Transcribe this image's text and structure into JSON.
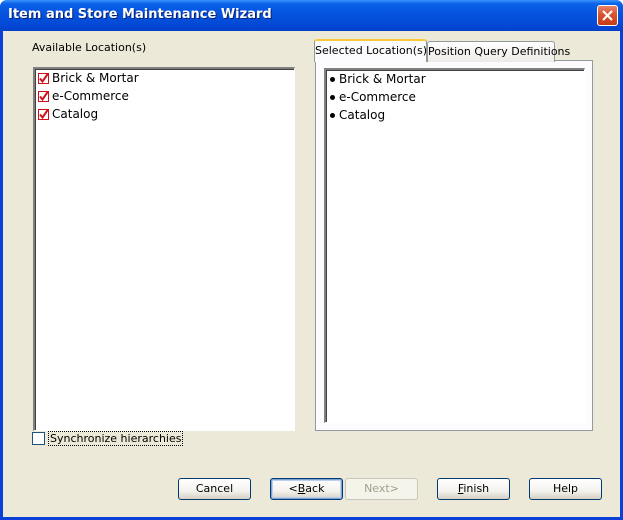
{
  "window": {
    "title": "Item and Store Maintenance Wizard"
  },
  "available": {
    "label": "Available Location(s)",
    "items": [
      {
        "label": "Brick & Mortar",
        "checked": true
      },
      {
        "label": "e-Commerce",
        "checked": true
      },
      {
        "label": "Catalog",
        "checked": true
      }
    ]
  },
  "tabs": [
    {
      "label": "Selected Location(s)",
      "active": true
    },
    {
      "label": "Position Query Definitions",
      "active": false
    }
  ],
  "selected": {
    "items": [
      {
        "label": "Brick & Mortar"
      },
      {
        "label": "e-Commerce"
      },
      {
        "label": "Catalog"
      }
    ]
  },
  "options": {
    "sync_label": "Synchronize hierarchies",
    "sync_checked": false
  },
  "buttons": {
    "cancel": "Cancel",
    "back_mnemonic": "B",
    "back_rest": "ack",
    "back_prefix": "<",
    "next": "Next>",
    "finish_mnemonic": "F",
    "finish_rest": "inish",
    "help": "Help"
  },
  "colors": {
    "titlebar": "#0554e0",
    "dialog_bg": "#ece9d8",
    "check_mark": "#d0101c",
    "tab_highlight": "#ffc83c"
  }
}
